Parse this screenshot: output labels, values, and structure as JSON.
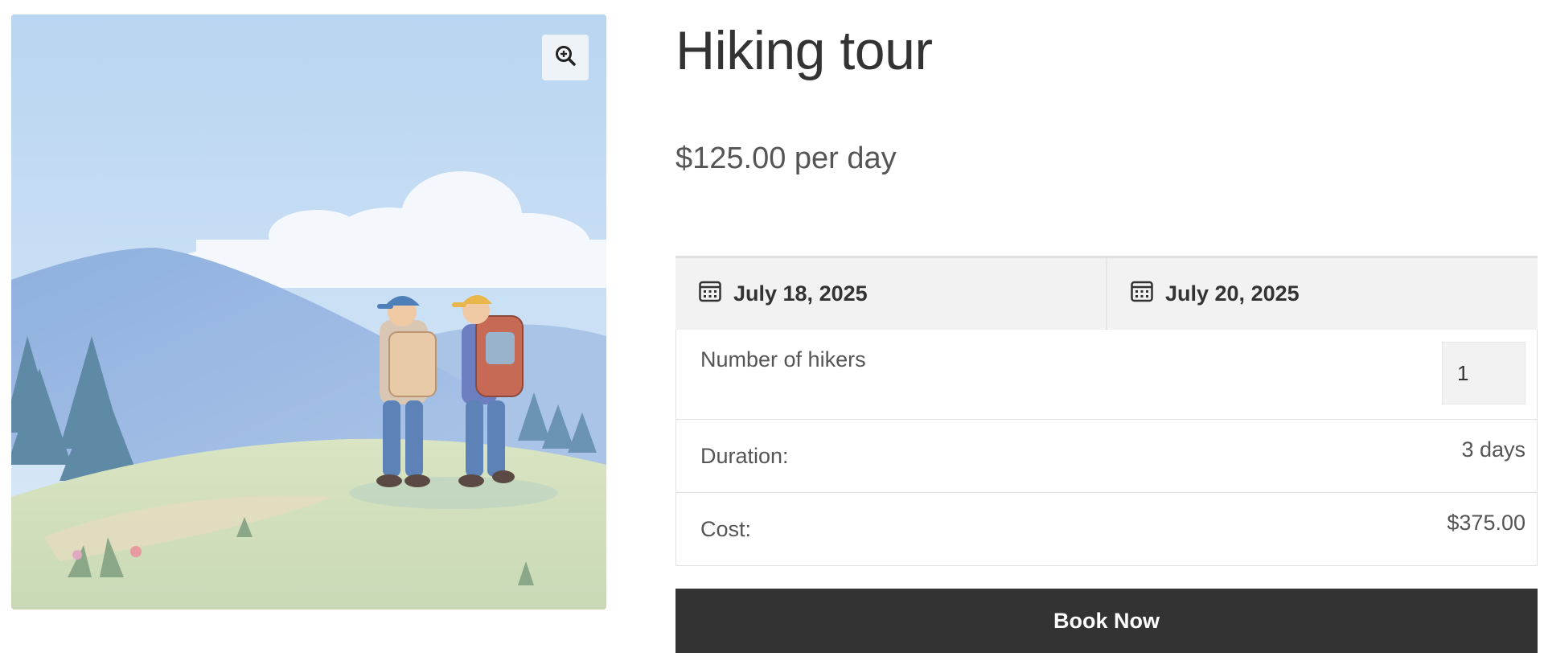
{
  "product": {
    "title": "Hiking tour",
    "price_line": "$125.00 per day"
  },
  "gallery": {
    "image_subject": "two hikers walking on a grassy hill toward blue mountains",
    "zoom_icon": "zoom-in-icon"
  },
  "booking": {
    "start_date": "July 18, 2025",
    "end_date": "July 20, 2025",
    "date_icon": "calendar-icon",
    "hikers_label": "Number of hikers",
    "hikers_value": "1",
    "duration_label": "Duration:",
    "duration_value": "3 days",
    "cost_label": "Cost:",
    "cost_value": "$375.00",
    "book_label": "Book Now"
  },
  "colors": {
    "button_bg": "#333333",
    "date_row_bg": "#f2f2f2",
    "sky": "#bcd8f2"
  }
}
